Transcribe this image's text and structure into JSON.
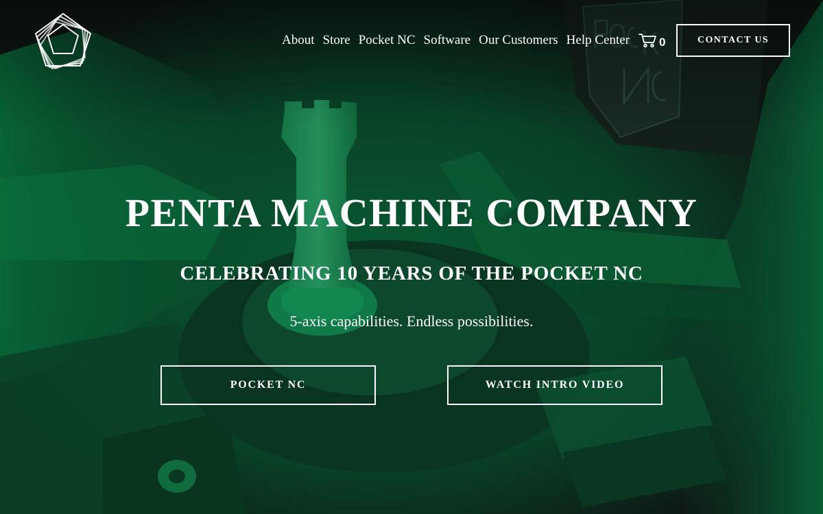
{
  "brand": {
    "logo_icon": "pentagon-logo-icon"
  },
  "nav": {
    "items": [
      {
        "label": "About"
      },
      {
        "label": "Store"
      },
      {
        "label": "Pocket NC"
      },
      {
        "label": "Software"
      },
      {
        "label": "Our Customers"
      },
      {
        "label": "Help Center"
      }
    ]
  },
  "cart": {
    "icon": "cart-icon",
    "count": "0"
  },
  "header": {
    "contact_label": "CONTACT US"
  },
  "hero": {
    "title": "PENTA MACHINE COMPANY",
    "subtitle": "CELEBRATING 10 YEARS OF THE POCKET NC",
    "tagline": "5-axis capabilities. Endless possibilities.",
    "primary_button": "POCKET NC",
    "secondary_button": "WATCH INTRO VIDEO",
    "background_tint": "#0b6b3e",
    "background_dark": "#141b18",
    "machine_badge_text": "POCKET NC"
  }
}
